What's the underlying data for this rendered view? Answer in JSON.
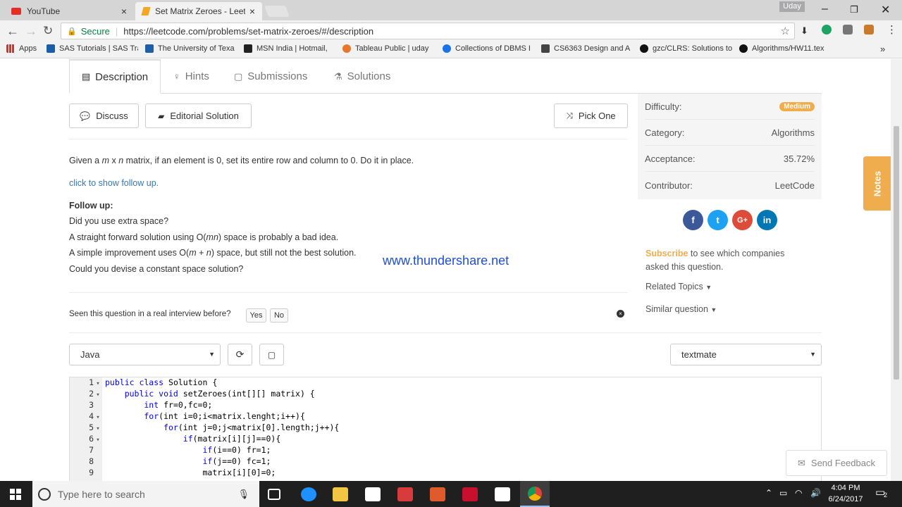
{
  "browser": {
    "tabs": [
      {
        "title": "YouTube",
        "active": false
      },
      {
        "title": "Set Matrix Zeroes - LeetC",
        "active": true
      }
    ],
    "user": "Uday",
    "secure_label": "Secure",
    "url": "https://leetcode.com/problems/set-matrix-zeroes/#/description",
    "bookmarks": [
      "Apps",
      "SAS Tutorials | SAS Tra",
      "The University of Texa",
      "MSN India | Hotmail,  ",
      "Tableau Public | uday",
      "Collections of DBMS I",
      "CS6363 Design and A",
      "gzc/CLRS: Solutions to",
      "Algorithms/HW11.tex"
    ],
    "more": "»"
  },
  "problem": {
    "tabs": [
      "Description",
      "Hints",
      "Submissions",
      "Solutions"
    ],
    "discuss_label": "Discuss",
    "editorial_label": "Editorial Solution",
    "pick_one_label": "Pick One",
    "statement": {
      "p1": "Given a ",
      "m": "m",
      "x": " x ",
      "n": "n",
      "p2": " matrix, if an element is 0, set its entire row and column to 0. Do it in place."
    },
    "follow_link": "click to show follow up.",
    "follow_title": "Follow up:",
    "follow_1": "Did you use extra space?",
    "follow_2a": "A straight forward solution using O(",
    "follow_2b": "mn",
    "follow_2c": ") space is probably a bad idea.",
    "follow_3a": "A simple improvement uses O(",
    "follow_3b": "m",
    "follow_3c": " + ",
    "follow_3d": "n",
    "follow_3e": ") space, but still not the best solution.",
    "follow_4": "Could you devise a constant space solution?",
    "watermark": "www.thundershare.net",
    "interview_q": "Seen this question in a real interview before?",
    "yes": "Yes",
    "no": "No"
  },
  "info": {
    "difficulty_label": "Difficulty:",
    "difficulty": "Medium",
    "category_label": "Category:",
    "category": "Algorithms",
    "acceptance_label": "Acceptance:",
    "acceptance": "35.72%",
    "contributor_label": "Contributor:",
    "contributor": "LeetCode",
    "subscribe": "Subscribe",
    "subscribe_rest": " to see which companies",
    "subscribe_line2": "asked this question.",
    "related_topics": "Related Topics",
    "similar_question": "Similar question",
    "notes": "Notes"
  },
  "editor": {
    "language": "Java",
    "theme": "textmate",
    "lines": [
      {
        "n": "1",
        "fold": true,
        "kw": "public class ",
        "rest": "Solution {"
      },
      {
        "n": "2",
        "fold": true,
        "kw": "    public void ",
        "rest": "setZeroes(int[][] matrix) {"
      },
      {
        "n": "3",
        "fold": false,
        "kw": "        int ",
        "rest": "fr=0,fc=0;"
      },
      {
        "n": "4",
        "fold": true,
        "kw": "        for",
        "rest": "(int i=0;i<matrix.lenght;i++){"
      },
      {
        "n": "5",
        "fold": true,
        "kw": "            for",
        "rest": "(int j=0;j<matrix[0].length;j++){"
      },
      {
        "n": "6",
        "fold": true,
        "kw": "                if",
        "rest": "(matrix[i][j]==0){"
      },
      {
        "n": "7",
        "fold": false,
        "kw": "                    if",
        "rest": "(i==0) fr=1;"
      },
      {
        "n": "8",
        "fold": false,
        "kw": "                    if",
        "rest": "(j==0) fc=1;"
      },
      {
        "n": "9",
        "fold": false,
        "kw": "                    ",
        "rest": "matrix[i][0]=0;"
      }
    ],
    "feedback": "Send Feedback"
  },
  "taskbar": {
    "search_placeholder": "Type here to search",
    "time": "4:04 PM",
    "date": "6/24/2017",
    "notif_count": "2"
  }
}
